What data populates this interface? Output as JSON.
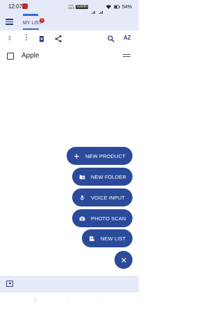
{
  "status_bar": {
    "time": "12:07",
    "net_label_top": "1.41",
    "net_label_bottom": "KB/S",
    "vowifi": "VoWiFi",
    "battery": "54%"
  },
  "header": {
    "tab_label": "MY LIST",
    "tab_badge": "1"
  },
  "toolbar": {
    "az_label": "AZ"
  },
  "list": {
    "items": [
      {
        "label": "Apple",
        "checked": false
      }
    ]
  },
  "fab_menu": {
    "new_product": "NEW PRODUCT",
    "new_folder": "NEW FOLDER",
    "voice_input": "VOICE INPUT",
    "photo_scan": "PHOTO SCAN",
    "new_list": "NEW LIST"
  },
  "colors": {
    "primary": "#2b4a9a",
    "header_bg": "#e6eaf8",
    "accent": "#2f6fd0",
    "badge": "#c62828"
  }
}
